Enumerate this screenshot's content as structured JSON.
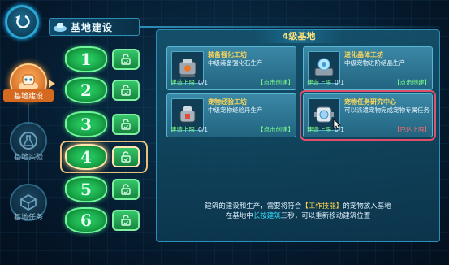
{
  "header": {
    "title": "基地建设"
  },
  "sidebar": {
    "items": [
      {
        "label": "基地建设",
        "active": true,
        "icon": "robot-icon"
      },
      {
        "label": "基地实验",
        "active": false,
        "icon": "flask-icon"
      },
      {
        "label": "基地任务",
        "active": false,
        "icon": "box-icon"
      }
    ]
  },
  "levels": {
    "items": [
      {
        "num": "1",
        "locked": false
      },
      {
        "num": "2",
        "locked": false
      },
      {
        "num": "3",
        "locked": false
      },
      {
        "num": "4",
        "locked": false,
        "selected": true
      },
      {
        "num": "5",
        "locked": false
      },
      {
        "num": "6",
        "locked": false
      }
    ]
  },
  "panel": {
    "title": "4级基地",
    "cards": [
      {
        "title": "装备强化工坊",
        "desc": "中级装备强化石生产",
        "limit_label": "建造上限",
        "count": "0/1",
        "action": "【点击创建】"
      },
      {
        "title": "进化晶体工坊",
        "desc": "中级宠物进阶结晶生产",
        "limit_label": "建造上限",
        "count": "0/1",
        "action": "【点击创建】"
      },
      {
        "title": "宠物经验工坊",
        "desc": "中级宠物经验丹生产",
        "limit_label": "建造上限",
        "count": "0/1",
        "action": "【点击创建】"
      },
      {
        "title": "宠物任务研究中心",
        "desc": "可以派遣宠物完成宠物专属任务",
        "limit_label": "建造上限",
        "count": "0/1",
        "action": "【已达上限】"
      }
    ],
    "tip": {
      "line1_a": "建筑的建设和生产，需要将符合",
      "line1_hl": "【工作技能】",
      "line1_b": "的宠物放入基地",
      "line2_a": "在基地中",
      "line2_hl": "长按建筑",
      "line2_b": "三秒，可以重新移动建筑位置"
    }
  },
  "colors": {
    "accent": "#2d8fb7",
    "level_green": "#1aa84a",
    "active_orange": "#d46a1f",
    "highlight_red": "#e0506a"
  }
}
